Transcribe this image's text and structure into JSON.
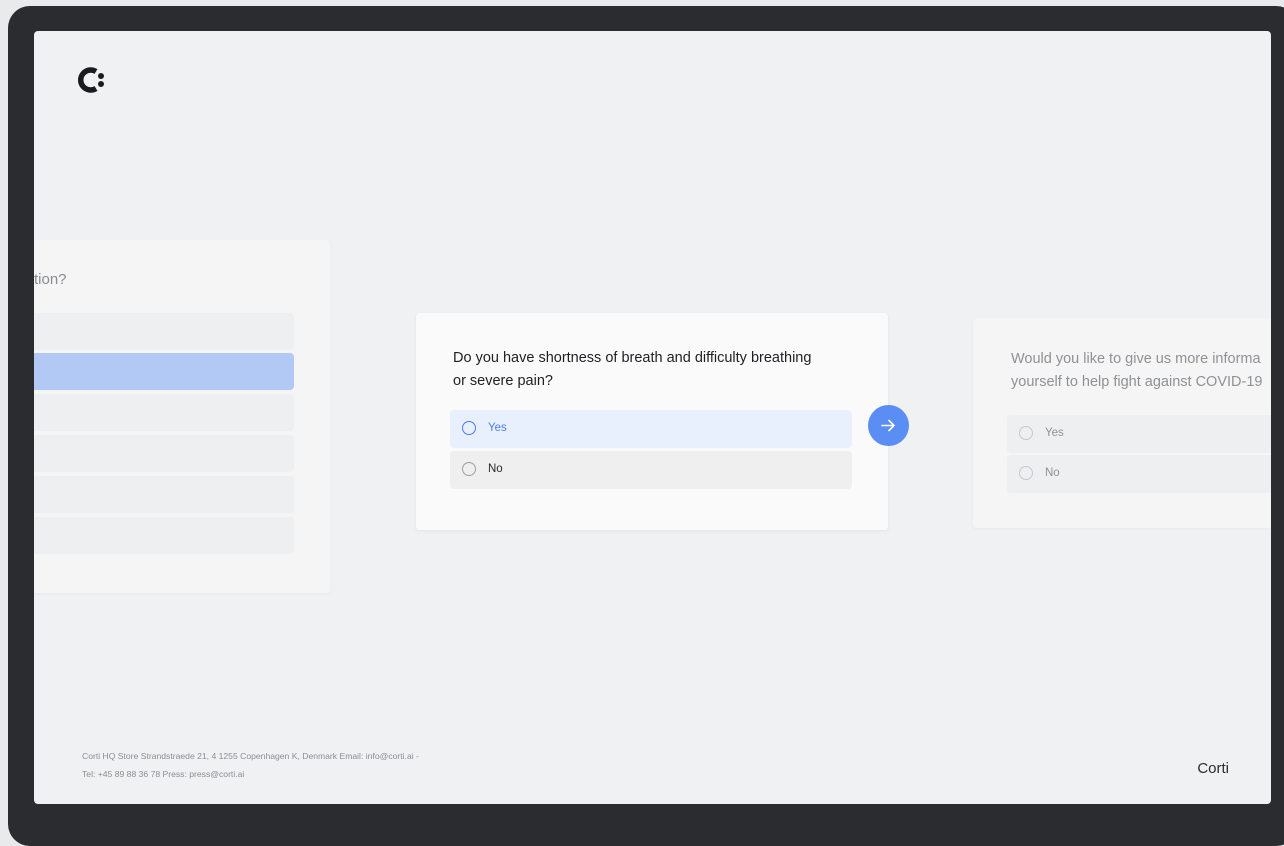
{
  "colors": {
    "accent": "#5a8ef5",
    "selected_text": "#4a7de8",
    "selected_option_bg": "#e8f0fd",
    "previous_selected_bg": "#b2c8f5",
    "device_frame": "#2b2c30",
    "screen_bg": "#f0f1f3"
  },
  "logo": {
    "icon": "corti-logo-icon"
  },
  "previous_card": {
    "question_fragment": "tion?"
  },
  "current_card": {
    "question": "Do you have shortness of breath and difficulty breathing or severe pain?",
    "options": [
      {
        "label": "Yes",
        "selected": true
      },
      {
        "label": "No",
        "selected": false
      }
    ],
    "next_icon": "arrow-right-icon"
  },
  "next_card": {
    "question_line1": "Would you like to give us more informa",
    "question_line2": "yourself to help fight against COVID-19",
    "options": [
      {
        "label": "Yes"
      },
      {
        "label": "No"
      }
    ]
  },
  "footer": {
    "address_line1": "Corti HQ Store Strandstraede 21, 4 1255 Copenhagen K, Denmark Email: info@corti.ai -",
    "address_line2": "Tel: +45 89 88 36 78 Press: press@corti.ai",
    "brand": "Corti"
  }
}
